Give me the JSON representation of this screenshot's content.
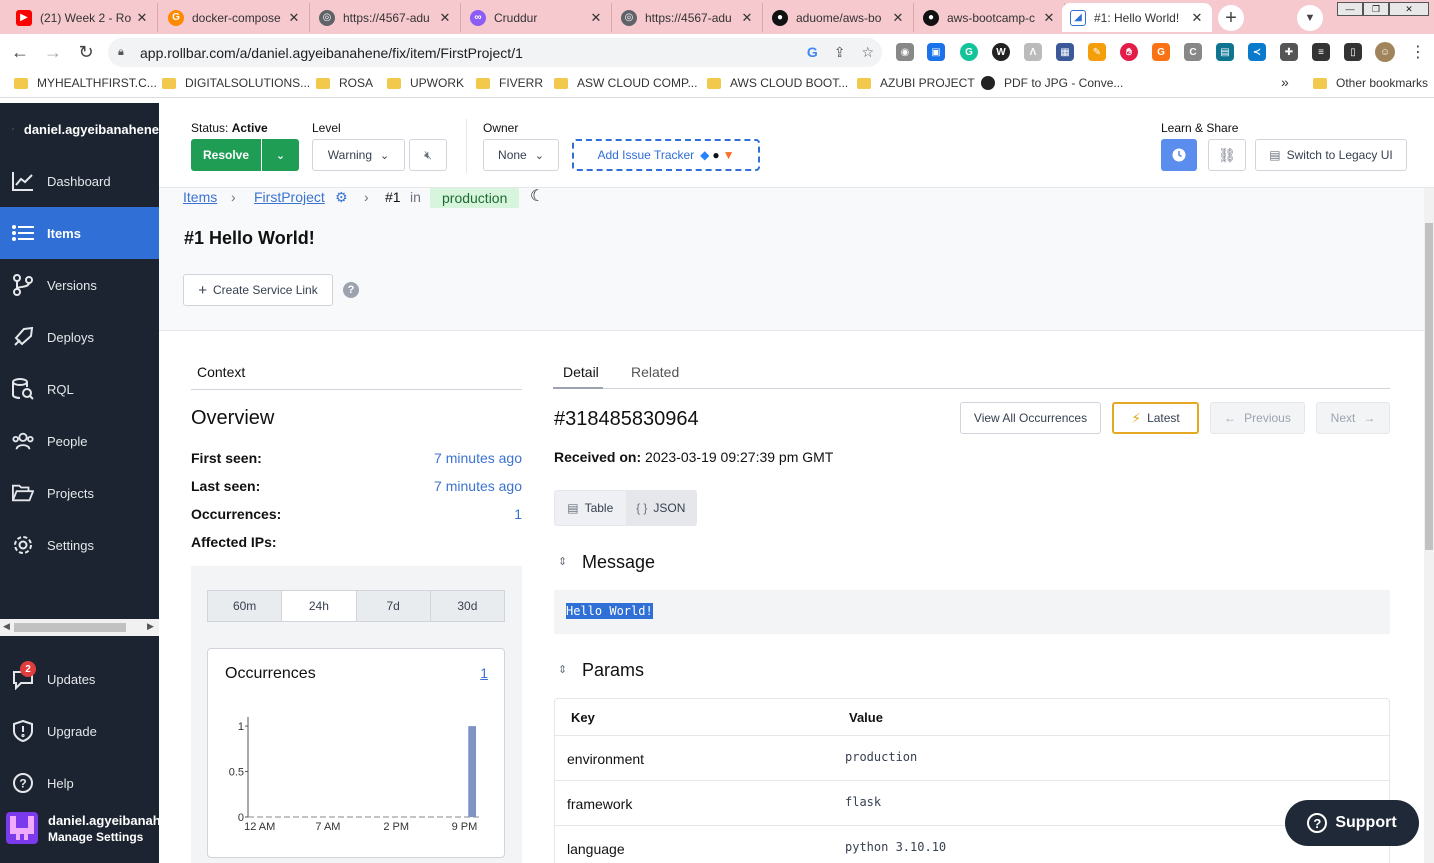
{
  "browser": {
    "tabs": [
      {
        "title": "(21) Week 2 - Ro",
        "icon": "youtube-icon",
        "color": "#ff0000"
      },
      {
        "title": "docker-compose",
        "icon": "gitpod-icon",
        "color": "#ff8a00"
      },
      {
        "title": "https://4567-adu",
        "icon": "globe-icon",
        "color": "#5f6368"
      },
      {
        "title": "Cruddur",
        "icon": "cruddur-icon",
        "color": "#8b5cf6"
      },
      {
        "title": "https://4567-adu",
        "icon": "globe-icon",
        "color": "#5f6368"
      },
      {
        "title": "aduome/aws-bo",
        "icon": "github-icon",
        "color": "#111111"
      },
      {
        "title": "aws-bootcamp-c",
        "icon": "github-icon",
        "color": "#111111"
      },
      {
        "title": "#1: Hello World!",
        "icon": "rollbar-icon",
        "color": "#2f6fd6"
      }
    ],
    "url": "app.rollbar.com/a/daniel.agyeibanahene/fix/item/FirstProject/1",
    "bookmarks": [
      "MYHEALTHFIRST.C...",
      "DIGITALSOLUTIONS...",
      "ROSA",
      "UPWORK",
      "FIVERR",
      "ASW CLOUD COMP...",
      "AWS CLOUD BOOT...",
      "AZUBI PROJECT",
      "PDF to JPG - Conve..."
    ],
    "other_bookmarks": "Other bookmarks",
    "more_bookmarks": "»"
  },
  "sidebar": {
    "account": "daniel.agyeibanahene",
    "items": [
      {
        "label": "Dashboard",
        "icon": "dashboard-icon"
      },
      {
        "label": "Items",
        "icon": "items-icon"
      },
      {
        "label": "Versions",
        "icon": "versions-icon"
      },
      {
        "label": "Deploys",
        "icon": "deploys-icon"
      },
      {
        "label": "RQL",
        "icon": "rql-icon"
      },
      {
        "label": "People",
        "icon": "people-icon"
      },
      {
        "label": "Projects",
        "icon": "projects-icon"
      },
      {
        "label": "Settings",
        "icon": "settings-icon"
      }
    ],
    "active": "Items",
    "bottom_items": [
      {
        "label": "Updates",
        "icon": "updates-icon",
        "badge": "2"
      },
      {
        "label": "Upgrade",
        "icon": "upgrade-icon"
      },
      {
        "label": "Help",
        "icon": "help-icon"
      }
    ],
    "user": {
      "name": "daniel.agyeibanahene",
      "sub": "Manage Settings"
    }
  },
  "topbar": {
    "status_label": "Status:",
    "status_value": "Active",
    "resolve": "Resolve",
    "level_label": "Level",
    "level_value": "Warning",
    "owner_label": "Owner",
    "owner_value": "None",
    "add_tracker": "Add Issue Tracker",
    "learn_share": "Learn & Share",
    "legacy": "Switch to Legacy UI"
  },
  "breadcrumb": {
    "items": "Items",
    "project": "FirstProject",
    "number": "#1",
    "in": "in",
    "env": "production"
  },
  "item": {
    "title": "#1 Hello World!",
    "service_link": "Create Service Link",
    "help": "?"
  },
  "context": {
    "tab": "Context",
    "overview": "Overview",
    "first_seen_label": "First seen:",
    "first_seen": "7 minutes ago",
    "last_seen_label": "Last seen:",
    "last_seen": "7 minutes ago",
    "occurrences_label": "Occurrences:",
    "occurrences": "1",
    "affected_ips_label": "Affected IPs:"
  },
  "graph": {
    "ranges": [
      "60m",
      "24h",
      "7d",
      "30d"
    ],
    "active_range": "24h",
    "title": "Occurrences",
    "count": "1"
  },
  "chart_data": {
    "type": "bar",
    "categories": [
      "12 AM",
      "7 AM",
      "2 PM",
      "9 PM"
    ],
    "x_ticks": [
      "12 AM",
      "7 AM",
      "2 PM",
      "9 PM"
    ],
    "y_ticks": [
      "1",
      "0.5",
      "0"
    ],
    "ylim": [
      0,
      1.1
    ],
    "values": [
      0,
      0,
      0,
      1
    ],
    "color": "#7f93c4"
  },
  "detail": {
    "tabs": [
      "Detail",
      "Related"
    ],
    "occurrence_id": "#318485830964",
    "received_label": "Received on:",
    "received_value": "2023-03-19 09:27:39 pm GMT",
    "view_all": "View All Occurrences",
    "latest": "Latest",
    "previous": "Previous",
    "next": "Next",
    "format_table": "Table",
    "format_json": "JSON",
    "message_title": "Message",
    "message": "Hello World!",
    "params_title": "Params",
    "params_headers": {
      "key": "Key",
      "value": "Value"
    },
    "params": [
      {
        "key": "environment",
        "value": "production"
      },
      {
        "key": "framework",
        "value": "flask"
      },
      {
        "key": "language",
        "value": "python 3.10.10"
      }
    ]
  },
  "support": "Support",
  "colors": {
    "accent": "#2f6fd6",
    "resolve": "#1f9d55",
    "sidebar": "#1b2430",
    "env_pill": "#d7f5dd"
  }
}
